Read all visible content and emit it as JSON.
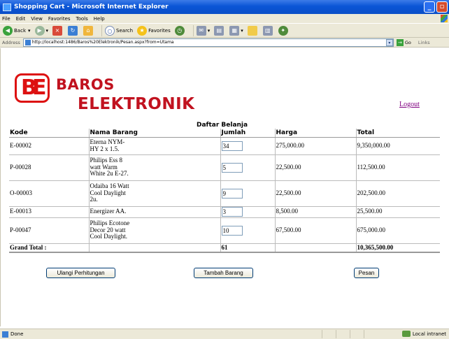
{
  "window": {
    "title": "Shopping Cart - Microsoft Internet Explorer",
    "minimize": "_",
    "maximize": "▫"
  },
  "menu": [
    "File",
    "Edit",
    "View",
    "Favorites",
    "Tools",
    "Help"
  ],
  "toolbar": {
    "back": "Back",
    "search": "Search",
    "favorites": "Favorites"
  },
  "address": {
    "label": "Address",
    "url": "http://localhost:1486/Baros%20Elektronik/Pesan.aspx?from=Utama",
    "go": "Go",
    "links": "Links"
  },
  "logo": {
    "line1": "BAROS",
    "line2": "ELEKTRONIK",
    "mark_letters": "BE"
  },
  "logout_label": "Logout",
  "page_title": "Daftar Belanja",
  "table": {
    "headers": [
      "Kode",
      "Nama Barang",
      "Jumlah",
      "Harga",
      "Total"
    ],
    "rows": [
      {
        "kode": "E-00002",
        "nama": [
          "Eterna NYM-",
          "HY 2 x 1.5."
        ],
        "jumlah": "34",
        "harga": "275,000.00",
        "total": "9,350,000.00"
      },
      {
        "kode": "P-00028",
        "nama": [
          "Philips Ess 8",
          "watt Warm",
          "White 2u E-27."
        ],
        "jumlah": "5",
        "harga": "22,500.00",
        "total": "112,500.00"
      },
      {
        "kode": "O-00003",
        "nama": [
          "Odaiba 16 Watt",
          "Cool Daylight",
          "2u."
        ],
        "jumlah": "9",
        "harga": "22,500.00",
        "total": "202,500.00"
      },
      {
        "kode": "E-00013",
        "nama": [
          "Energizer AA."
        ],
        "jumlah": "3",
        "harga": "8,500.00",
        "total": "25,500.00"
      },
      {
        "kode": "P-00047",
        "nama": [
          "Philips Ecotone",
          "Decor 20 watt",
          "Cool Daylight."
        ],
        "jumlah": "10",
        "harga": "67,500.00",
        "total": "675,000.00"
      }
    ],
    "grand_total_label": "Grand Total :",
    "grand_total_qty": "61",
    "grand_total_amount": "10,365,500.00"
  },
  "buttons": {
    "recalculate": "Ulangi Perhitungan",
    "add_item": "Tambah Barang",
    "order": "Pesan"
  },
  "status": {
    "text": "Done",
    "zone": "Local intranet"
  }
}
